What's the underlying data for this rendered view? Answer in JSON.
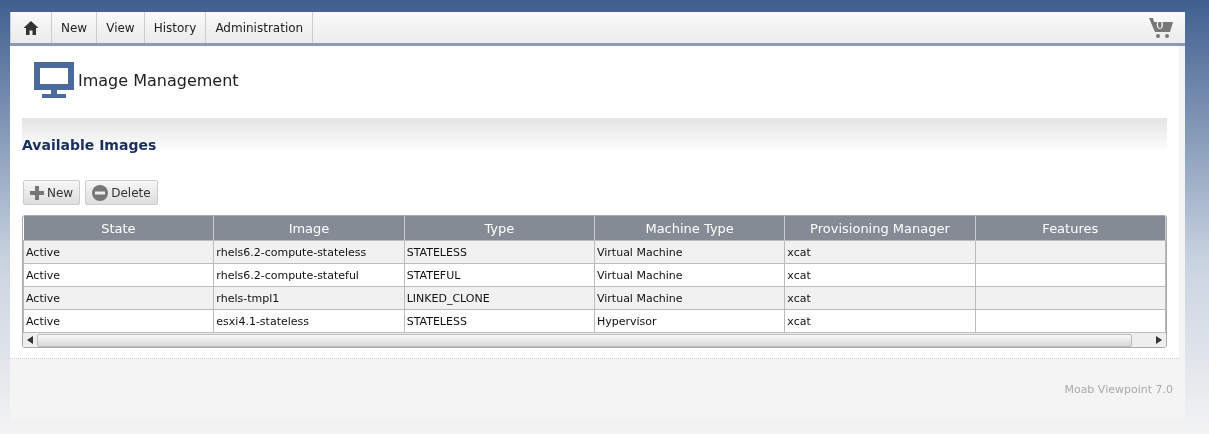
{
  "nav": {
    "items": [
      {
        "label": "New"
      },
      {
        "label": "View"
      },
      {
        "label": "History"
      },
      {
        "label": "Administration"
      }
    ],
    "cart_count": "0"
  },
  "page": {
    "title": "Image Management"
  },
  "section": {
    "title": "Available Images"
  },
  "toolbar": [
    {
      "label": "New",
      "kind": "add"
    },
    {
      "label": "Delete",
      "kind": "delete"
    }
  ],
  "table": {
    "columns": [
      "State",
      "Image",
      "Type",
      "Machine Type",
      "Provisioning Manager",
      "Features"
    ],
    "rows": [
      [
        "Active",
        "rhels6.2-compute-stateless",
        "STATELESS",
        "Virtual Machine",
        "xcat",
        ""
      ],
      [
        "Active",
        "rhels6.2-compute-stateful",
        "STATEFUL",
        "Virtual Machine",
        "xcat",
        ""
      ],
      [
        "Active",
        "rhels-tmpl1",
        "LINKED_CLONE",
        "Virtual Machine",
        "xcat",
        ""
      ],
      [
        "Active",
        "esxi4.1-stateless",
        "STATELESS",
        "Hypervisor",
        "xcat",
        ""
      ]
    ]
  },
  "footer": {
    "text": "Moab Viewpoint 7.0"
  }
}
